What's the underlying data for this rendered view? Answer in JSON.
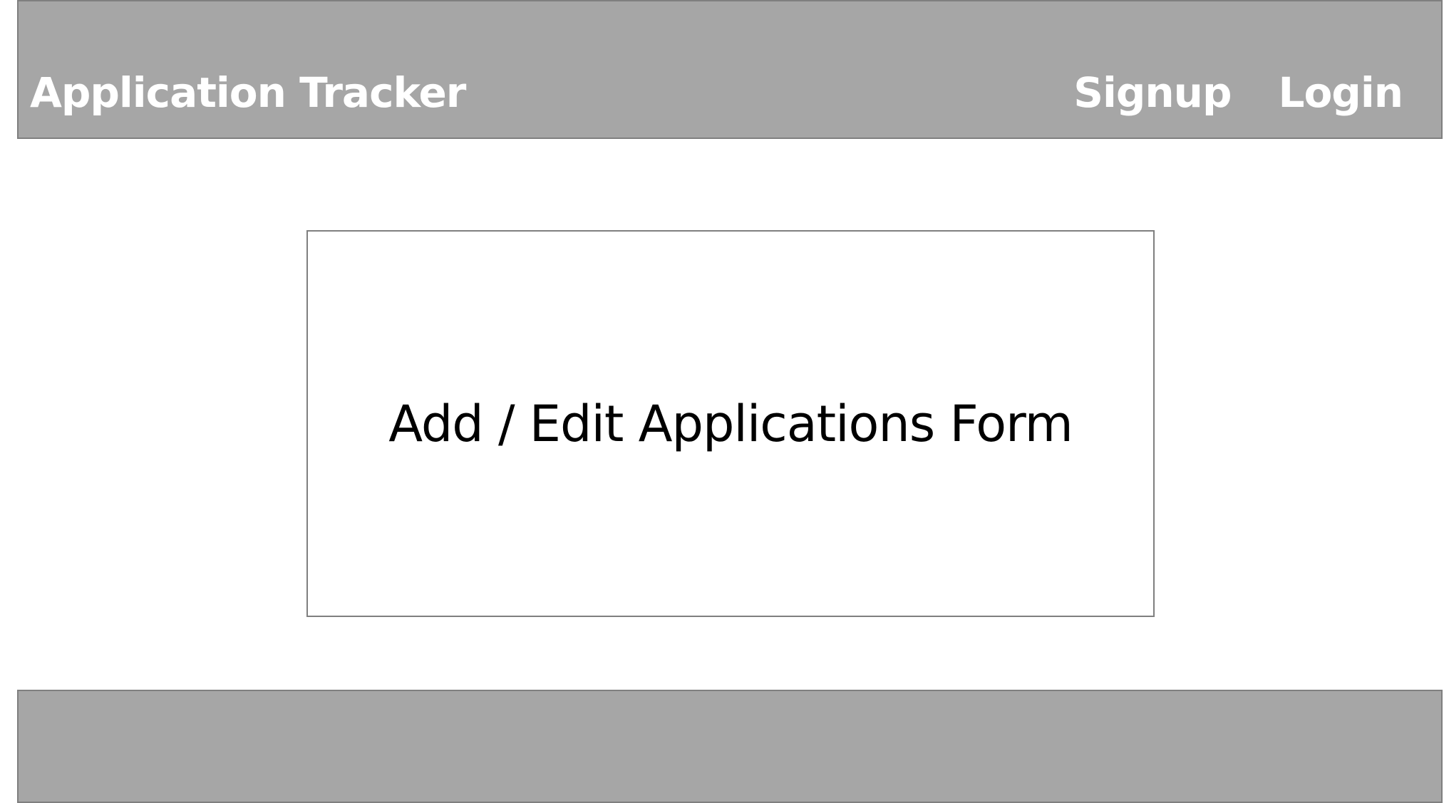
{
  "header": {
    "title": "Application Tracker",
    "nav": {
      "signup_label": "Signup",
      "login_label": "Login"
    }
  },
  "main": {
    "form_placeholder_label": "Add / Edit Applications Form"
  },
  "colors": {
    "bar_background": "#a6a6a6",
    "bar_border": "#7f7f7f",
    "header_text": "#ffffff",
    "panel_background": "#ffffff",
    "panel_text": "#000000"
  }
}
